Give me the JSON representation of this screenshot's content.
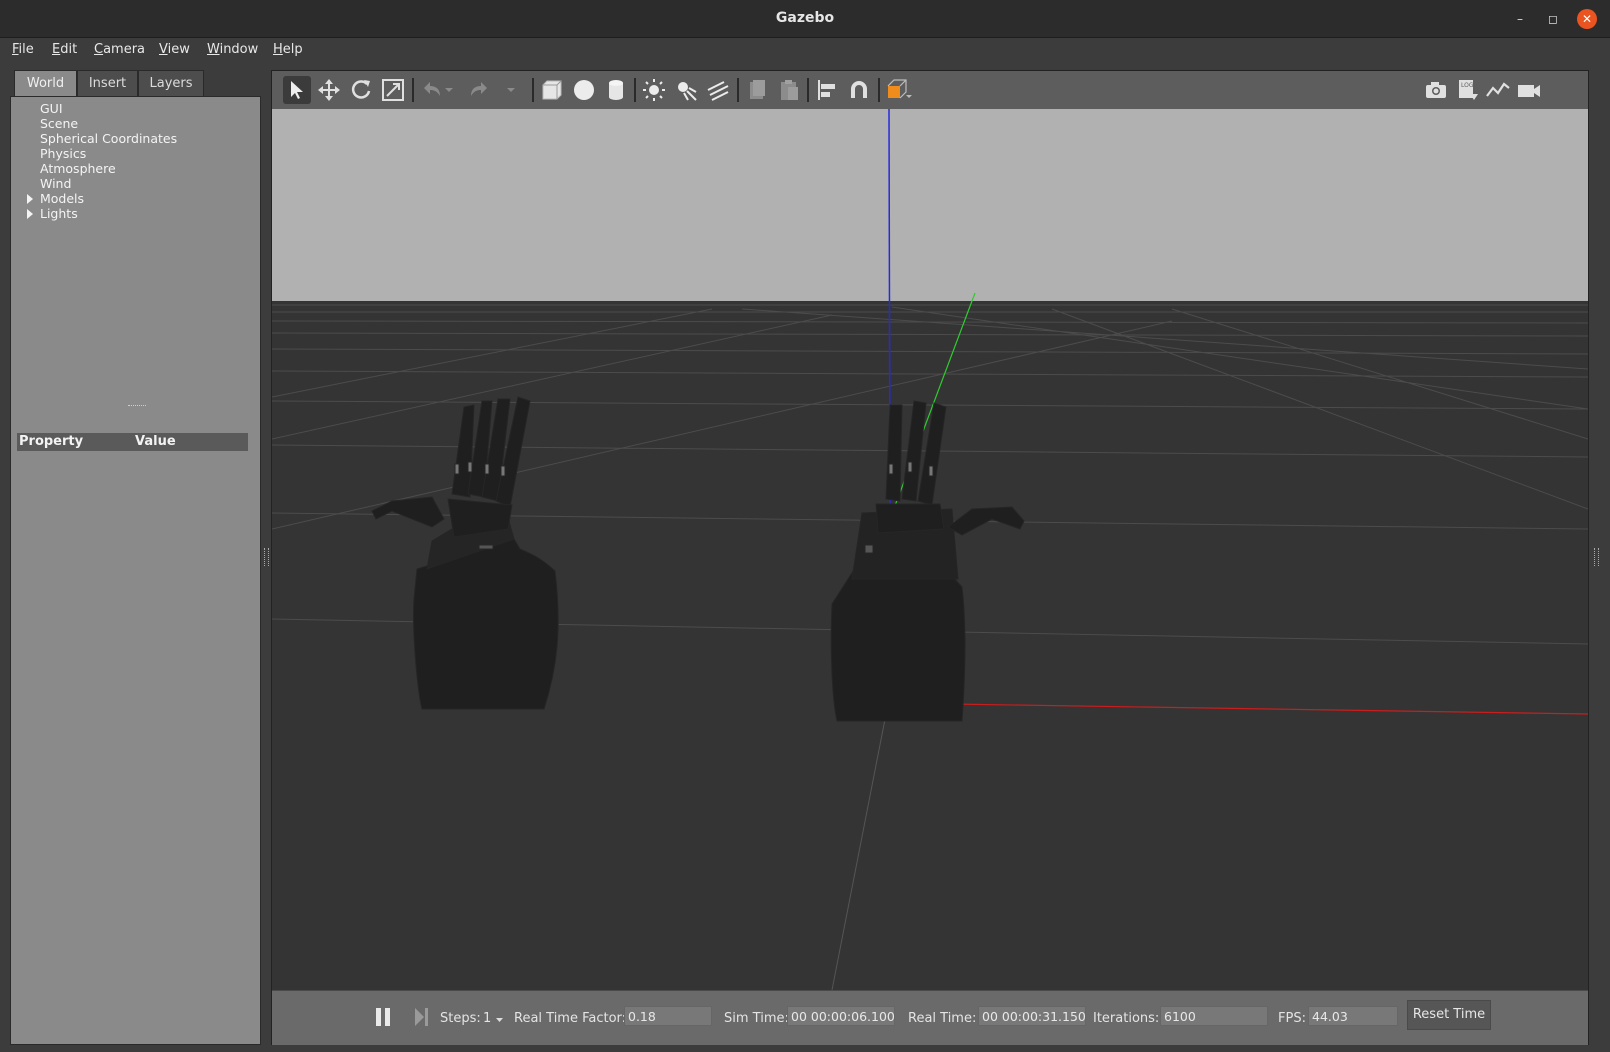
{
  "window": {
    "title": "Gazebo"
  },
  "menu": [
    "File",
    "Edit",
    "Camera",
    "View",
    "Window",
    "Help"
  ],
  "left_panel": {
    "tabs": [
      "World",
      "Insert",
      "Layers"
    ],
    "active_tab": "World",
    "tree_items": [
      "GUI",
      "Scene",
      "Spherical Coordinates",
      "Physics",
      "Atmosphere",
      "Wind",
      "Models",
      "Lights"
    ],
    "expandable": [
      "Models",
      "Lights"
    ],
    "property_header": {
      "property": "Property",
      "value": "Value"
    }
  },
  "toolbar": {
    "tools": [
      "select-tool",
      "translate-tool",
      "rotate-tool",
      "scale-tool",
      "undo",
      "undo-history",
      "redo",
      "redo-history",
      "box-shape",
      "sphere-shape",
      "cylinder-shape",
      "point-light",
      "spot-light",
      "directional-light",
      "copy",
      "paste",
      "align",
      "snap",
      "view-angle"
    ],
    "right_tools": [
      "screenshot",
      "log-recorder",
      "plot",
      "video-recorder"
    ],
    "selected_tool": "select-tool",
    "accent_color": "#f08c1c"
  },
  "scene": {
    "sky_color": "#b1b1b1",
    "ground_color": "#343434",
    "axis_colors": {
      "x": "#c81e1e",
      "y": "#2ecc2e",
      "z": "#2828e0"
    }
  },
  "bottom_bar": {
    "steps_label": "Steps:",
    "steps_value": "1",
    "rtf_label": "Real Time Factor:",
    "rtf_value": "0.18",
    "sim_time_label": "Sim Time:",
    "sim_time_value": "00 00:00:06.100",
    "real_time_label": "Real Time:",
    "real_time_value": "00 00:00:31.150",
    "iterations_label": "Iterations:",
    "iterations_value": "6100",
    "fps_label": "FPS:",
    "fps_value": "44.03",
    "reset_label": "Reset Time"
  }
}
